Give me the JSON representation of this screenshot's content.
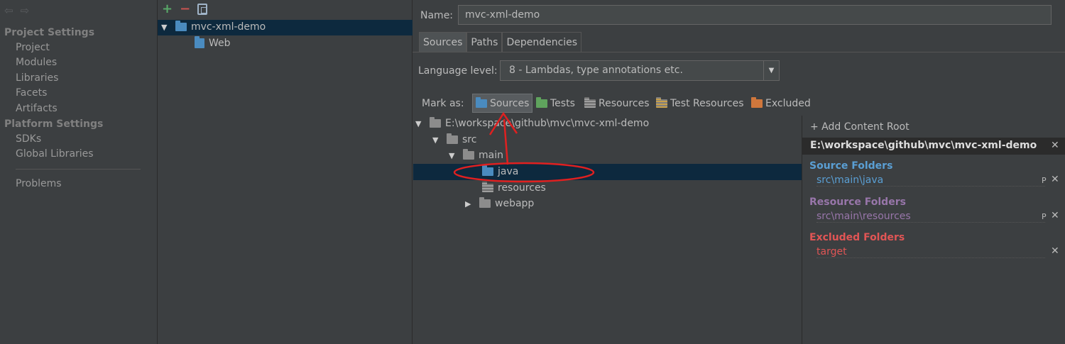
{
  "sidebar": {
    "project_settings": "Project Settings",
    "platform_settings": "Platform Settings",
    "items": [
      "Project",
      "Modules",
      "Libraries",
      "Facets",
      "Artifacts"
    ],
    "platform_items": [
      "SDKs",
      "Global Libraries"
    ],
    "problems": "Problems"
  },
  "modules": {
    "module_name": "mvc-xml-demo",
    "facet": "Web"
  },
  "main": {
    "name_label": "Name:",
    "name_value": "mvc-xml-demo",
    "tabs": [
      "Sources",
      "Paths",
      "Dependencies"
    ],
    "language_level_label": "Language level:",
    "language_level_value": "8 - Lambdas, type annotations etc.",
    "mark_as_label": "Mark as:",
    "mark_buttons": [
      "Sources",
      "Tests",
      "Resources",
      "Test Resources",
      "Excluded"
    ]
  },
  "tree": {
    "root": "E:\\workspace\\github\\mvc\\mvc-xml-demo",
    "src": "src",
    "main": "main",
    "java": "java",
    "resources": "resources",
    "webapp": "webapp"
  },
  "content_roots": {
    "add_label": "+ Add Content Root",
    "root_path": "E:\\workspace\\github\\mvc\\mvc-xml-demo",
    "source_title": "Source Folders",
    "source_item": "src\\main\\java",
    "resource_title": "Resource Folders",
    "resource_item": "src\\main\\resources",
    "excluded_title": "Excluded Folders",
    "excluded_item": "target"
  },
  "colors": {
    "source": "#5a9fd4",
    "resource": "#9876aa",
    "excluded": "#e05555",
    "selection": "#0d293e",
    "annotation": "#e02020"
  }
}
